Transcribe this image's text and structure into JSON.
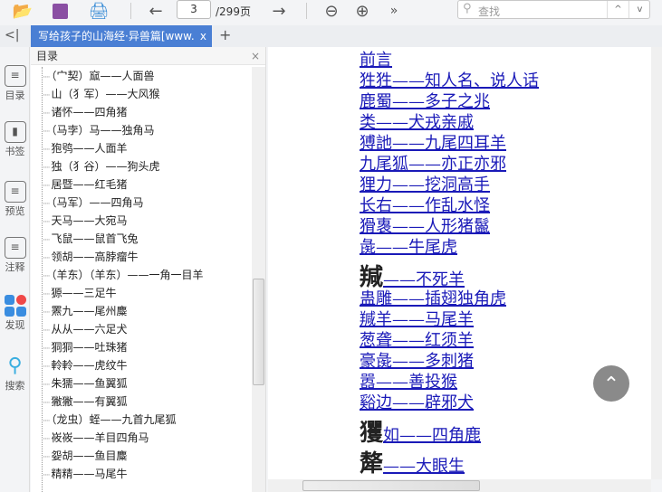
{
  "toolbar": {
    "page_current": "3",
    "page_total": "/299页",
    "search_placeholder": "查找",
    "more": "»",
    "up": "^",
    "down": "v"
  },
  "tabs": {
    "collapse": "<|",
    "doc_title": "写给孩子的山海经·异兽篇[www.",
    "close": "x",
    "add": "+"
  },
  "rail": [
    {
      "label": "目录"
    },
    {
      "label": "书签"
    },
    {
      "label": "预览"
    },
    {
      "label": "注释"
    },
    {
      "label": "发现"
    },
    {
      "label": "搜索"
    }
  ],
  "toc": {
    "title": "目录",
    "close": "×",
    "items": [
      "（宀契）窳——人面兽",
      "山（犭军）——大风猴",
      "诸怀——四角猪",
      "（马孛）马——独角马",
      "狍鸮——人面羊",
      "独（犭谷）——狗头虎",
      "居暨——红毛猪",
      "（马军）——四角马",
      "天马——大宛马",
      "飞鼠——鼠首飞兔",
      "领胡——高脖瘤牛",
      "（羊东）（羊东）——一角一目羊",
      "獂——三足牛",
      "罴九——尾州麋",
      "从从——六足犬",
      "狪狪——吐珠猪",
      "軨軨——虎纹牛",
      "朱獳——鱼翼狐",
      "獙獙——有翼狐",
      "（龙虫）蛭——九首九尾狐",
      "峳峳——羊目四角马",
      "妴胡——鱼目麋",
      "精精——马尾牛"
    ]
  },
  "content": {
    "lines": [
      {
        "prefix": "",
        "text": "前言"
      },
      {
        "prefix": "",
        "text": "狌狌——知人名、说人话"
      },
      {
        "prefix": "",
        "text": "鹿蜀——多子之兆"
      },
      {
        "prefix": "",
        "text": "类——犬戎亲戚"
      },
      {
        "prefix": "",
        "text": "猼訑——九尾四耳羊"
      },
      {
        "prefix": "",
        "text": "九尾狐——亦正亦邪"
      },
      {
        "prefix": "",
        "text": "狸力——挖洞高手"
      },
      {
        "prefix": "",
        "text": "长右——作乱水怪"
      },
      {
        "prefix": "",
        "text": "猾褢——人形猪鬣"
      },
      {
        "prefix": "",
        "text": "彘——牛尾虎"
      },
      {
        "prefix": "羬",
        "text": "——不死羊"
      },
      {
        "prefix": "",
        "text": "蛊雕——插翅独角虎"
      },
      {
        "prefix": "",
        "text": "羬羊——马尾羊"
      },
      {
        "prefix": "",
        "text": "葱聋——红须羊"
      },
      {
        "prefix": "",
        "text": "豪彘——多刺猪"
      },
      {
        "prefix": "",
        "text": "嚣——善投猴"
      },
      {
        "prefix": "",
        "text": "谿边——辟邪犬"
      },
      {
        "prefix": "玃",
        "text": "如——四角鹿"
      },
      {
        "prefix": "犛",
        "text": "——大眼生"
      }
    ]
  }
}
